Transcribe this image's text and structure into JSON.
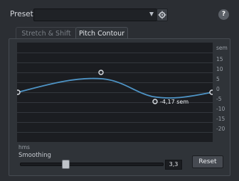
{
  "presets": {
    "label": "Presets",
    "value": ""
  },
  "tabs": [
    {
      "label": "Stretch & Shift",
      "active": false
    },
    {
      "label": "Pitch Contour",
      "active": true
    }
  ],
  "graph": {
    "unit": "sem",
    "y_ticks": [
      "15",
      "10",
      "5",
      "0",
      "-5",
      "-10",
      "-15",
      "-20"
    ],
    "x_label": "hms",
    "selected_point_label": "-4,17 sem",
    "colors": {
      "curve": "#4e94c6",
      "background": "#1b1d21"
    }
  },
  "smoothing": {
    "label": "Smoothing",
    "value": "3,3",
    "fraction": 0.33
  },
  "reset_label": "Reset",
  "help_label": "?",
  "icons": {
    "dropdown": "chevron-down-icon",
    "settings": "gear-icon",
    "help": "help-icon"
  }
}
